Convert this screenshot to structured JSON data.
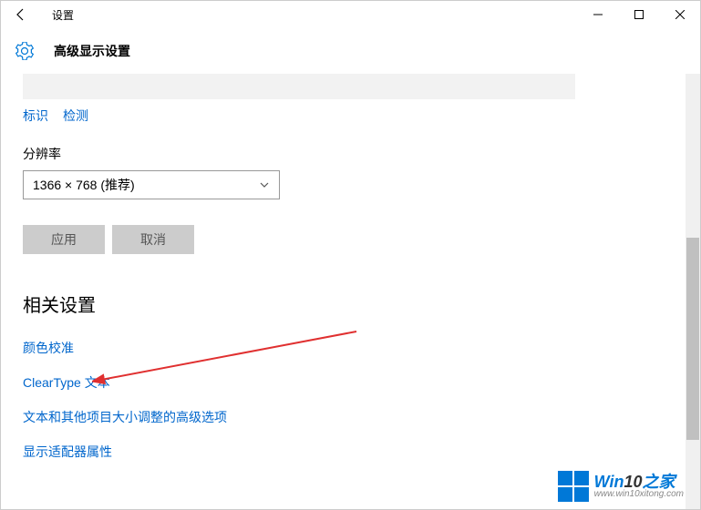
{
  "titlebar": {
    "title": "设置"
  },
  "header": {
    "page_title": "高级显示设置"
  },
  "links": {
    "identify": "标识",
    "detect": "检测"
  },
  "resolution": {
    "label": "分辨率",
    "selected": "1366 × 768 (推荐)"
  },
  "buttons": {
    "apply": "应用",
    "cancel": "取消"
  },
  "related": {
    "title": "相关设置",
    "items": [
      "颜色校准",
      "ClearType 文本",
      "文本和其他项目大小调整的高级选项",
      "显示适配器属性"
    ]
  },
  "watermark": {
    "brand_a": "Win",
    "brand_b": "10",
    "brand_c": "之家",
    "url": "www.win10xitong.com"
  }
}
